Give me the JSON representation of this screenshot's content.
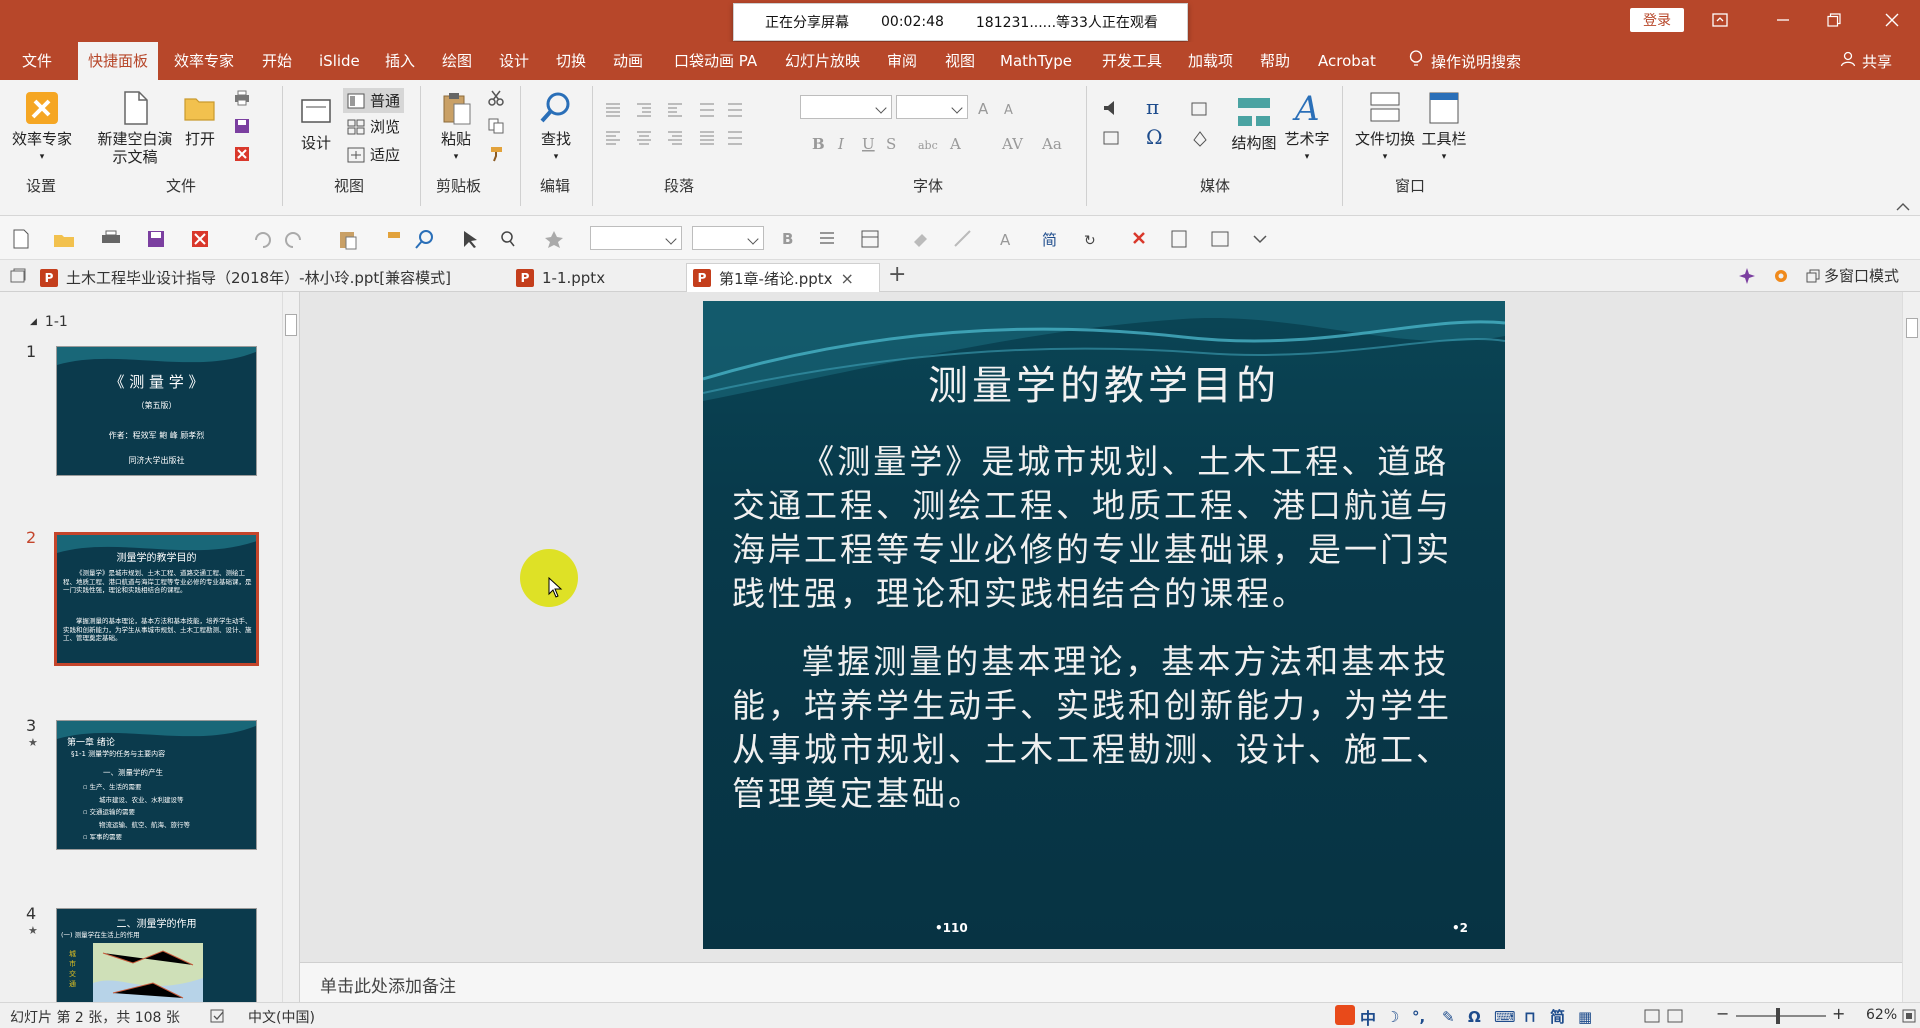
{
  "share_banner": {
    "status": "正在分享屏幕",
    "timer": "00:02:48",
    "viewers": "181231......等33人正在观看"
  },
  "titlebar": {
    "login": "登录"
  },
  "menu": {
    "tabs": [
      "文件",
      "快捷面板",
      "效率专家",
      "开始",
      "iSlide",
      "插入",
      "绘图",
      "设计",
      "切换",
      "动画",
      "口袋动画 PA",
      "幻灯片放映",
      "审阅",
      "视图",
      "MathType",
      "开发工具",
      "加载项",
      "帮助",
      "Acrobat"
    ],
    "active": "快捷面板",
    "search": "操作说明搜索",
    "share": "共享"
  },
  "ribbon": {
    "groups": {
      "settings": "设置",
      "file": "文件",
      "view": "视图",
      "clipboard": "剪贴板",
      "edit": "编辑",
      "paragraph": "段落",
      "font": "字体",
      "media": "媒体",
      "window": "窗口"
    },
    "buttons": {
      "efficiency": "效率专家",
      "new_blank": "新建空白演",
      "new_blank2": "示文稿",
      "open": "打开",
      "design": "设计",
      "normal": "普通",
      "browse": "浏览",
      "fit": "适应",
      "paste": "粘贴",
      "find": "查找",
      "smartart": "结构图",
      "wordart": "艺术字",
      "file_switch": "文件切换",
      "toolbar": "工具栏"
    }
  },
  "doc_tabs": [
    {
      "label": "土木工程毕业设计指导（2018年）-林小玲.ppt[兼容模式]"
    },
    {
      "label": "1-1.pptx"
    },
    {
      "label": "第1章-绪论.pptx"
    }
  ],
  "multi_window": "多窗口模式",
  "outline": {
    "section": "1-1"
  },
  "thumbnails": [
    {
      "num": "1",
      "title": "《 测 量 学 》",
      "sub": "（第五版）",
      "author": "作者：程效军  鲍 峰  顾孝烈",
      "publisher": "同济大学出版社"
    },
    {
      "num": "2",
      "title": "测量学的教学目的"
    },
    {
      "num": "3",
      "title": "第一章   绪论",
      "sub": "§1-1  测量学的任务与主要内容",
      "h": "一、测量学的产生",
      "lines": [
        "▫ 生产、生活的需要",
        "城市建设、农业、水利建设等",
        "▫ 交通运输的需要",
        "物流运输、航空、航海、旅行等",
        "▫ 军事的需要"
      ]
    },
    {
      "num": "4",
      "title": "二、测量学的作用",
      "sub": "(一) 测量学在生活上的作用"
    }
  ],
  "slide": {
    "title": "测量学的教学目的",
    "p1": "《测量学》是城市规划、土木工程、道路交通工程、测绘工程、地质工程、港口航道与海岸工程等专业必修的专业基础课，是一门实践性强，理论和实践相结合的课程。",
    "p2": "掌握测量的基本理论，基本方法和基本技能，培养学生动手、实践和创新能力，为学生从事城市规划、土木工程勘测、设计、施工、管理奠定基础。",
    "footer_left": "•110",
    "footer_right": "•2"
  },
  "notes": {
    "placeholder": "单击此处添加备注"
  },
  "status": {
    "slide_info": "幻灯片 第 2 张，共 108 张",
    "language": "中文(中国)",
    "ime": "中",
    "zoom": "62%"
  }
}
